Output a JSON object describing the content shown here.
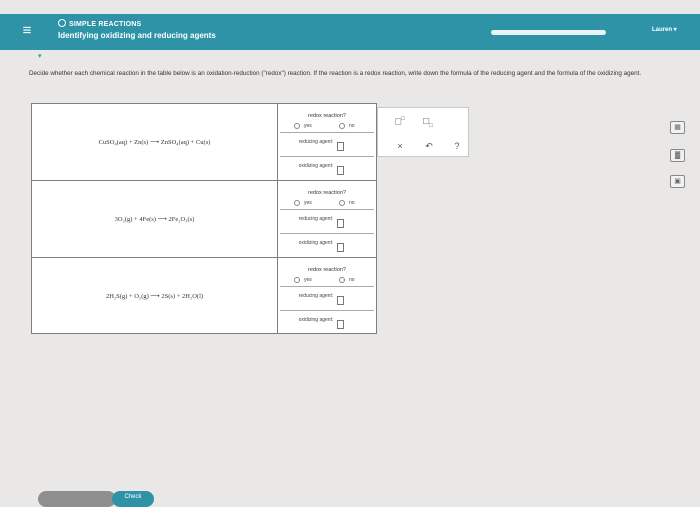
{
  "header": {
    "menu_icon": "hamburger-icon",
    "topic": "SIMPLE REACTIONS",
    "title": "Identifying oxidizing and reducing agents",
    "user": "Lauren ▾",
    "progress": 1.0,
    "collapse_icon": "▾"
  },
  "instructions": "Decide whether each chemical reaction in the table below is an oxidation-reduction (\"redox\") reaction. If the reaction is a redox reaction, write down the formula of the reducing agent and the formula of the oxidizing agent.",
  "labels": {
    "redox_question": "redox reaction?",
    "yes": "yes",
    "no": "no",
    "reducing": "reducing agent:",
    "oxidizing": "oxidizing agent:"
  },
  "reactions": [
    "CuSO₄(aq) + Zn(s) ⟶ ZnSO₄(aq) + Cu(s)",
    "3O₂(g) + 4Fe(s) ⟶ 2Fe₂O₃(s)",
    "2H₂S(g) + O₂(g) ⟶ 2S(s) + 2H₂O(l)"
  ],
  "tools": {
    "superscript": "□□",
    "subscript": "□□",
    "clear": "×",
    "undo": "↶",
    "help": "?"
  },
  "side_icons": [
    "calculator-icon",
    "chart-icon",
    "periodic-table-icon"
  ],
  "bottom": {
    "explanation": "",
    "check": "Check"
  },
  "colors": {
    "teal": "#2f93a8",
    "background": "#e9e8e6"
  }
}
